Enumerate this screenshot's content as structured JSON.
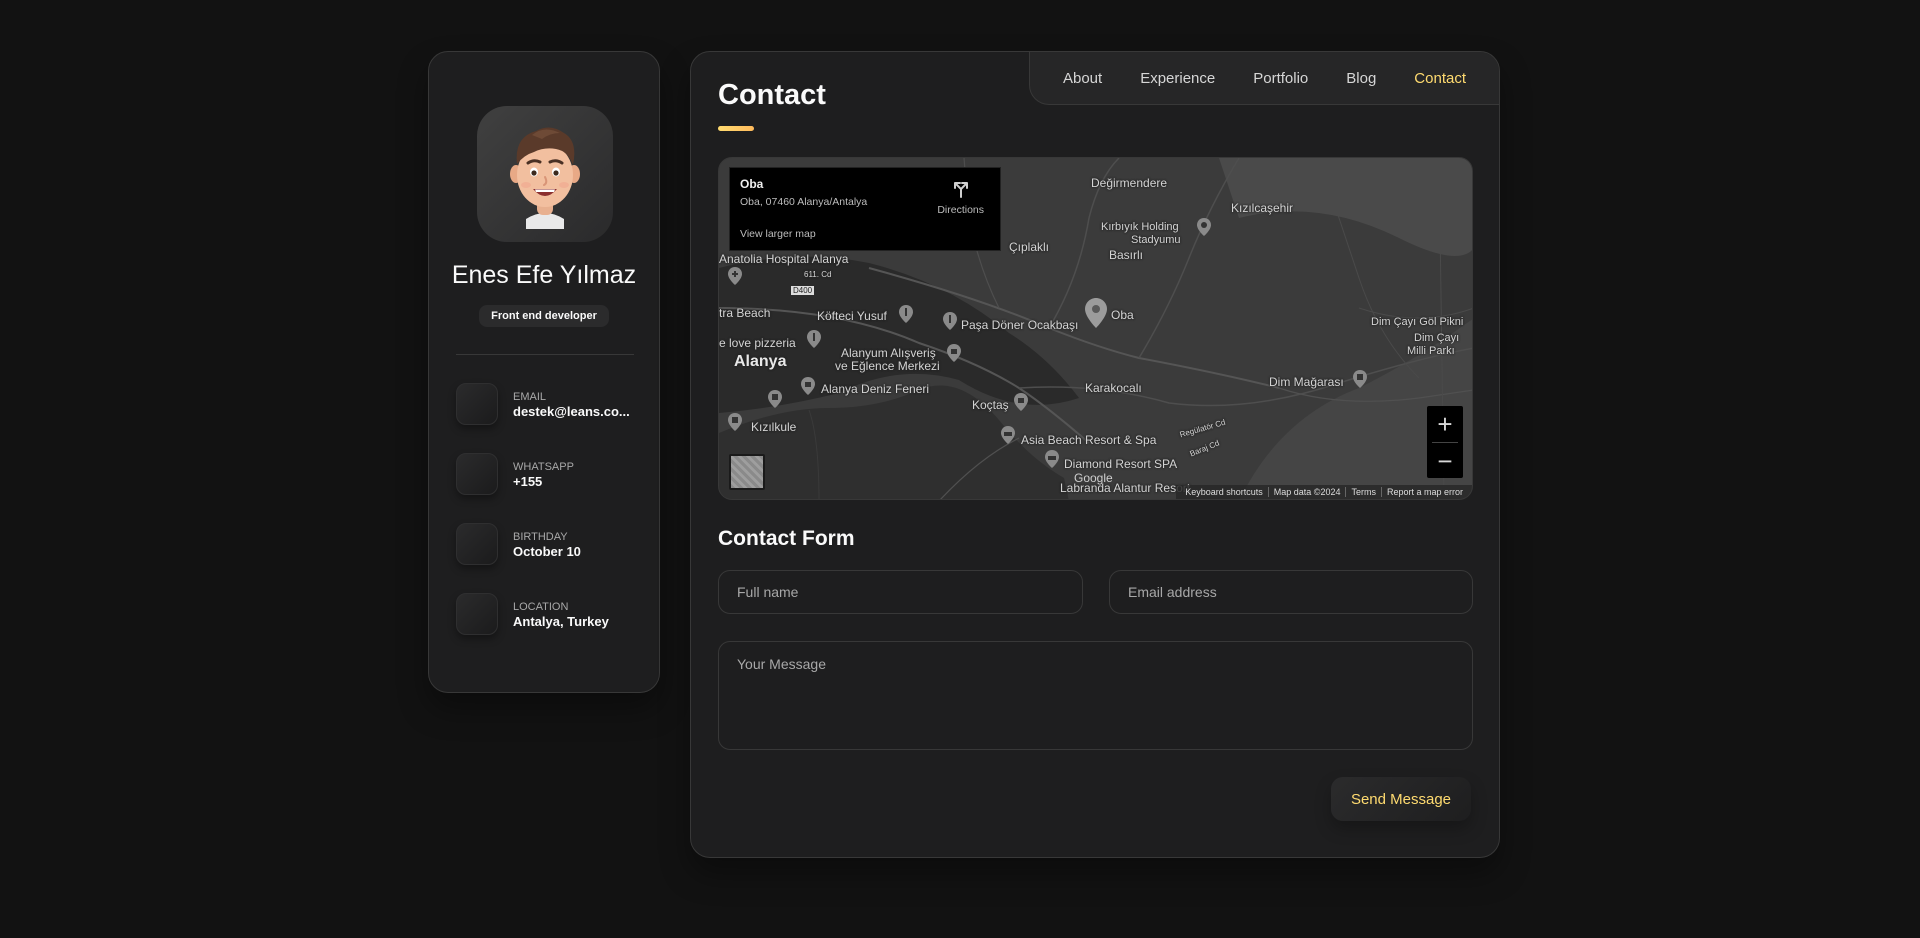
{
  "sidebar": {
    "name": "Enes Efe Yılmaz",
    "title": "Front end developer",
    "contacts": [
      {
        "label": "Email",
        "value": "destek@leans.co..."
      },
      {
        "label": "WhatsApp",
        "value": "+155"
      },
      {
        "label": "Birthday",
        "value": "October 10"
      },
      {
        "label": "Location",
        "value": "Antalya, Turkey"
      }
    ]
  },
  "nav": {
    "items": [
      {
        "label": "About"
      },
      {
        "label": "Experience"
      },
      {
        "label": "Portfolio"
      },
      {
        "label": "Blog"
      },
      {
        "label": "Contact"
      }
    ],
    "active": "Contact"
  },
  "page": {
    "title": "Contact"
  },
  "map": {
    "info": {
      "place": "Oba",
      "address": "Oba, 07460 Alanya/Antalya",
      "directions": "Directions",
      "larger_map": "View larger map"
    },
    "labels": {
      "degirmendere": "Değirmendere",
      "kizilcasehir": "Kızılcaşehir",
      "kirbiyik": "Kırbıyık Holding",
      "stadyumu": "Stadyumu",
      "ciplakli": "Çıplaklı",
      "basirli": "Basırlı",
      "anatolia": "Anatolia Hospital Alanya",
      "road611": "611. Cd",
      "d400": "D400",
      "kofteci": "Köfteci Yusuf",
      "pasa": "Paşa Döner Ocakbaşı",
      "oba": "Oba",
      "beach": "tra Beach",
      "lovepizza": "e love pizzeria",
      "alanya": "Alanya",
      "alanyum1": "Alanyum Alışveriş",
      "alanyum2": "ve Eğlence Merkezi",
      "deniz": "Alanya Deniz Feneri",
      "koctas": "Koçtaş",
      "karakocali": "Karakocalı",
      "kizilkule": "Kızılkule",
      "asia": "Asia Beach Resort & Spa",
      "diamond": "Diamond Resort SPA",
      "labranda": "Labranda Alantur Resort",
      "dimmagara": "Dim Mağarası",
      "dimcay1": "Dim Çayı Göl Pikni",
      "dimcay2": "Dim Çayı",
      "milli": "Milli Parkı",
      "regulator": "Regülatör Cd",
      "barajcd": "Baraj Cd",
      "google": "Google"
    },
    "controls": {
      "zoom_in": "+",
      "zoom_out": "−"
    },
    "footer": [
      "Keyboard shortcuts",
      "Map data ©2024",
      "Terms",
      "Report a map error"
    ]
  },
  "form": {
    "title": "Contact Form",
    "fullname_placeholder": "Full name",
    "email_placeholder": "Email address",
    "message_placeholder": "Your Message",
    "submit_label": "Send Message"
  },
  "colors": {
    "accent": "#ffdb70",
    "background": "#121212",
    "card": "#1e1e1f",
    "border": "#383838"
  }
}
